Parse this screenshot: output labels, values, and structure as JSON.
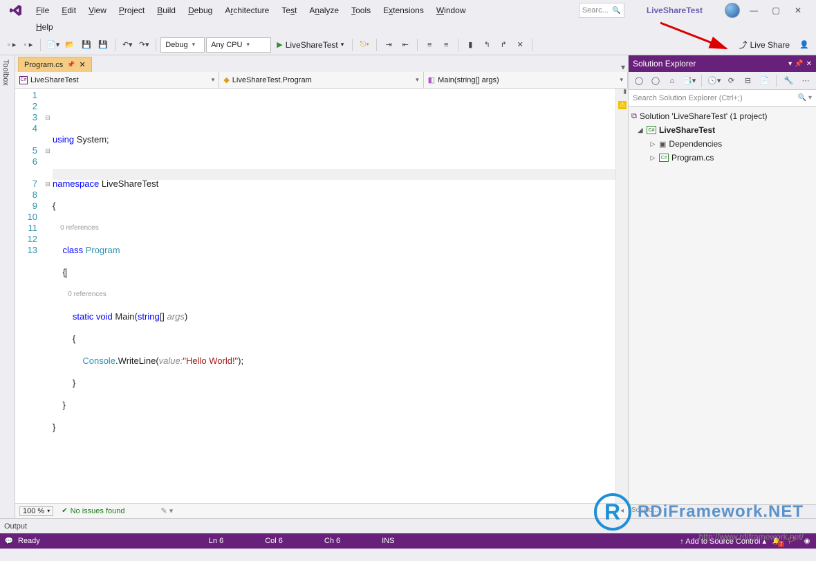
{
  "menu": {
    "items": [
      "File",
      "Edit",
      "View",
      "Project",
      "Build",
      "Debug",
      "Architecture",
      "Test",
      "Analyze",
      "Tools",
      "Extensions",
      "Window"
    ],
    "items2": [
      "Help"
    ],
    "search_placeholder": "Searc...",
    "app_title": "LiveShareTest"
  },
  "toolbar": {
    "config": "Debug",
    "platform": "Any CPU",
    "run_target": "LiveShareTest",
    "live_share": "Live Share"
  },
  "toolbox_label": "Toolbox",
  "doc_tab": {
    "name": "Program.cs"
  },
  "nav": {
    "project": "LiveShareTest",
    "class": "LiveShareTest.Program",
    "method": "Main(string[] args)"
  },
  "code": {
    "references_label": "0 references",
    "lines": [
      "1",
      "2",
      "3",
      "4",
      "5",
      "6",
      "7",
      "8",
      "9",
      "10",
      "11",
      "12",
      "13"
    ],
    "hello": "\"Hello World!\"",
    "value_hint": "value:",
    "namespace": "LiveShareTest",
    "class_name": "Program",
    "method_name": "Main"
  },
  "editor_status": {
    "zoom": "100 %",
    "issues": "No issues found"
  },
  "solution_explorer": {
    "title": "Solution Explorer",
    "search_placeholder": "Search Solution Explorer (Ctrl+;)",
    "solution": "Solution 'LiveShareTest' (1 project)",
    "project": "LiveShareTest",
    "dependencies": "Dependencies",
    "program": "Program.cs",
    "footer": "Solutio..."
  },
  "output_label": "Output",
  "statusbar": {
    "ready": "Ready",
    "ln": "Ln 6",
    "col": "Col 6",
    "ch": "Ch 6",
    "ins": "INS",
    "add_source": "Add to Source Control"
  },
  "watermark": {
    "brand": "RDiFramework.NET",
    "url": "http://www.rdiframework.net/"
  }
}
